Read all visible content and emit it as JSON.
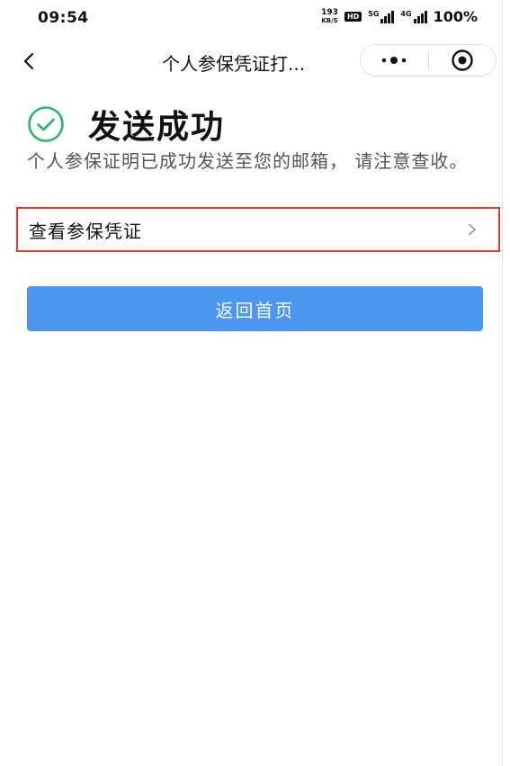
{
  "status_bar": {
    "time": "09:54",
    "net_speed_value": "193",
    "net_speed_unit": "KB/S",
    "hd_label": "HD",
    "signal_1_label": "5G",
    "signal_2_label": "4G",
    "battery": "100%"
  },
  "nav": {
    "title": "个人参保凭证打..."
  },
  "result": {
    "title": "发送成功",
    "description": "个人参保证明已成功发送至您的邮箱， 请注意查收。",
    "icon_color": "#2bb866"
  },
  "actions": {
    "view_voucher_label": "查看参保凭证",
    "home_label": "返回首页",
    "primary_color": "#4b96f0",
    "highlight_color": "#e33d2a"
  }
}
